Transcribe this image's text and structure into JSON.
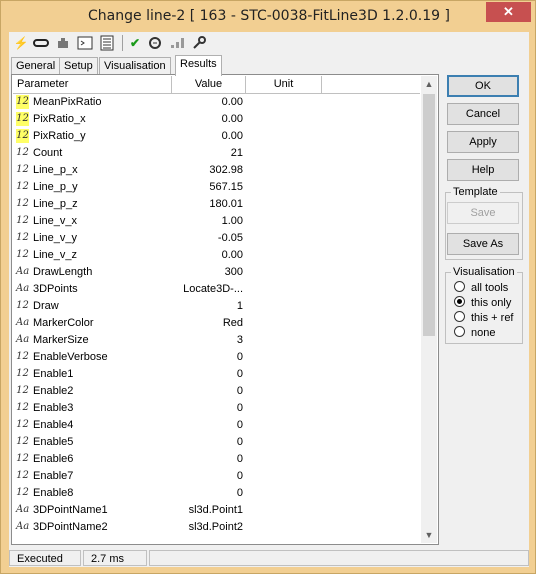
{
  "window": {
    "title": "Change line-2 [ 163 - STC-0038-FitLine3D 1.2.0.19 ]",
    "close_label": "✕"
  },
  "toolbar": {
    "icons": [
      "lightning-icon",
      "link-icon",
      "plugin-icon",
      "console-icon",
      "list-icon",
      "checkmark-icon",
      "magic-icon",
      "network-icon",
      "wrench-icon"
    ]
  },
  "tabs": [
    {
      "label": "General"
    },
    {
      "label": "Setup"
    },
    {
      "label": "Visualisation"
    },
    {
      "label": "Results",
      "active": true
    }
  ],
  "table": {
    "columns": [
      "Parameter",
      "Value",
      "Unit"
    ],
    "rows": [
      {
        "type": "12",
        "highlight": true,
        "name": "MeanPixRatio",
        "value": "0.00"
      },
      {
        "type": "12",
        "highlight": true,
        "name": "PixRatio_x",
        "value": "0.00"
      },
      {
        "type": "12",
        "highlight": true,
        "name": "PixRatio_y",
        "value": "0.00"
      },
      {
        "type": "12",
        "highlight": false,
        "name": "Count",
        "value": "21"
      },
      {
        "type": "12",
        "highlight": false,
        "name": "Line_p_x",
        "value": "302.98"
      },
      {
        "type": "12",
        "highlight": false,
        "name": "Line_p_y",
        "value": "567.15"
      },
      {
        "type": "12",
        "highlight": false,
        "name": "Line_p_z",
        "value": "180.01"
      },
      {
        "type": "12",
        "highlight": false,
        "name": "Line_v_x",
        "value": "1.00"
      },
      {
        "type": "12",
        "highlight": false,
        "name": "Line_v_y",
        "value": "-0.05"
      },
      {
        "type": "12",
        "highlight": false,
        "name": "Line_v_z",
        "value": "0.00"
      },
      {
        "type": "Aa",
        "highlight": false,
        "name": "DrawLength",
        "value": "300"
      },
      {
        "type": "Aa",
        "highlight": false,
        "name": "3DPoints",
        "value": "Locate3D-..."
      },
      {
        "type": "12",
        "highlight": false,
        "name": "Draw",
        "value": "1"
      },
      {
        "type": "Aa",
        "highlight": false,
        "name": "MarkerColor",
        "value": "Red"
      },
      {
        "type": "Aa",
        "highlight": false,
        "name": "MarkerSize",
        "value": "3"
      },
      {
        "type": "12",
        "highlight": false,
        "name": "EnableVerbose",
        "value": "0"
      },
      {
        "type": "12",
        "highlight": false,
        "name": "Enable1",
        "value": "0"
      },
      {
        "type": "12",
        "highlight": false,
        "name": "Enable2",
        "value": "0"
      },
      {
        "type": "12",
        "highlight": false,
        "name": "Enable3",
        "value": "0"
      },
      {
        "type": "12",
        "highlight": false,
        "name": "Enable4",
        "value": "0"
      },
      {
        "type": "12",
        "highlight": false,
        "name": "Enable5",
        "value": "0"
      },
      {
        "type": "12",
        "highlight": false,
        "name": "Enable6",
        "value": "0"
      },
      {
        "type": "12",
        "highlight": false,
        "name": "Enable7",
        "value": "0"
      },
      {
        "type": "12",
        "highlight": false,
        "name": "Enable8",
        "value": "0"
      },
      {
        "type": "Aa",
        "highlight": false,
        "name": "3DPointName1",
        "value": "sl3d.Point1"
      },
      {
        "type": "Aa",
        "highlight": false,
        "name": "3DPointName2",
        "value": "sl3d.Point2"
      }
    ]
  },
  "buttons": {
    "ok": "OK",
    "cancel": "Cancel",
    "apply": "Apply",
    "help": "Help"
  },
  "template": {
    "title": "Template",
    "save": "Save",
    "save_as": "Save As"
  },
  "visualisation": {
    "title": "Visualisation",
    "options": [
      {
        "label": "all tools",
        "selected": false
      },
      {
        "label": "this only",
        "selected": true
      },
      {
        "label": "this + ref",
        "selected": false
      },
      {
        "label": "none",
        "selected": false
      }
    ]
  },
  "status": {
    "state": "Executed",
    "time": "2.7 ms"
  },
  "colors": {
    "frame": "#f2cf92",
    "close": "#c75050",
    "highlight": "#ffff66"
  }
}
